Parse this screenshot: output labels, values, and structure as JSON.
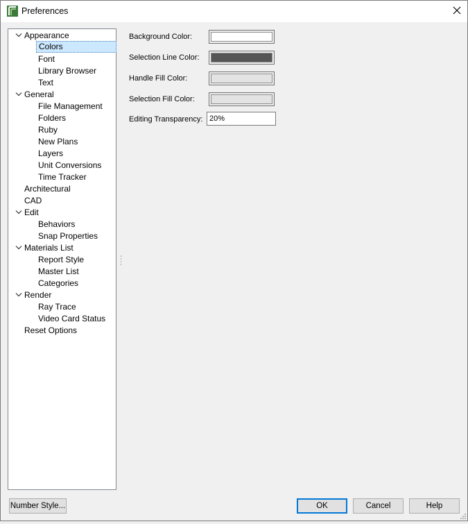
{
  "window": {
    "title": "Preferences"
  },
  "icons": {
    "app": "chief-architect-app-icon",
    "close": "close-icon",
    "expand": "chevron-down-icon"
  },
  "colors": {
    "background_color": "#ffffff",
    "selection_line_color": "#555555",
    "handle_fill_color": "#e3e3e3",
    "selection_fill_color": "#e3e3e3",
    "selected_tree_highlight": "#cce8ff"
  },
  "tree": {
    "items": [
      {
        "label": "Appearance",
        "expanded": true
      },
      {
        "label": "Colors",
        "selected": true
      },
      {
        "label": "Font"
      },
      {
        "label": "Library Browser"
      },
      {
        "label": "Text"
      },
      {
        "label": "General",
        "expanded": true
      },
      {
        "label": "File Management"
      },
      {
        "label": "Folders"
      },
      {
        "label": "Ruby"
      },
      {
        "label": "New Plans"
      },
      {
        "label": "Layers"
      },
      {
        "label": "Unit Conversions"
      },
      {
        "label": "Time Tracker"
      },
      {
        "label": "Architectural"
      },
      {
        "label": "CAD"
      },
      {
        "label": "Edit",
        "expanded": true
      },
      {
        "label": "Behaviors"
      },
      {
        "label": "Snap Properties"
      },
      {
        "label": "Materials List",
        "expanded": true
      },
      {
        "label": "Report Style"
      },
      {
        "label": "Master List"
      },
      {
        "label": "Categories"
      },
      {
        "label": "Render",
        "expanded": true
      },
      {
        "label": "Ray Trace"
      },
      {
        "label": "Video Card Status"
      },
      {
        "label": "Reset Options"
      }
    ]
  },
  "form": {
    "background_color_label": "Background Color:",
    "selection_line_color_label": "Selection Line Color:",
    "handle_fill_color_label": "Handle Fill Color:",
    "selection_fill_color_label": "Selection Fill Color:",
    "editing_transparency_label": "Editing Transparency:",
    "editing_transparency_value": "20%"
  },
  "buttons": {
    "number_style": "Number Style...",
    "ok": "OK",
    "cancel": "Cancel",
    "help": "Help"
  }
}
